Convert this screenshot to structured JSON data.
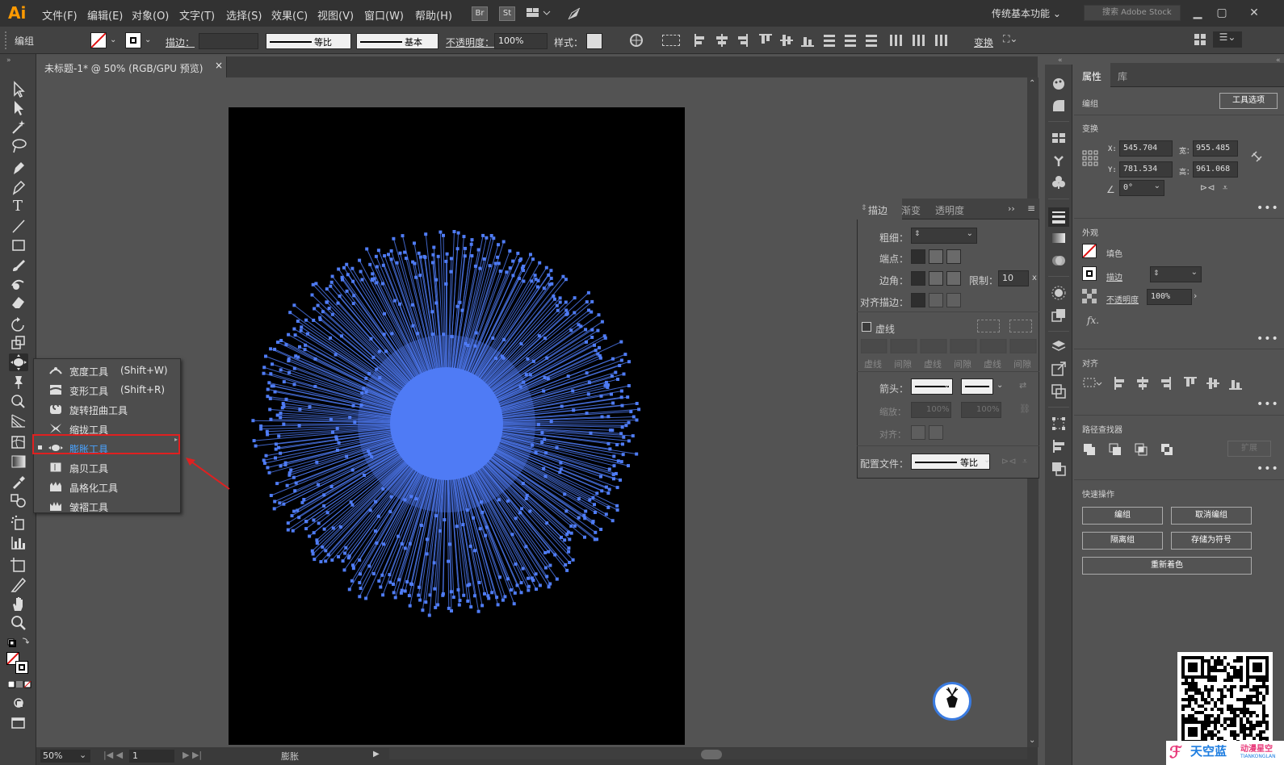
{
  "app": {
    "logo": "Ai",
    "workspace": "传统基本功能",
    "search_placeholder": "搜索 Adobe Stock"
  },
  "menu": [
    "文件(F)",
    "编辑(E)",
    "对象(O)",
    "文字(T)",
    "选择(S)",
    "效果(C)",
    "视图(V)",
    "窗口(W)",
    "帮助(H)"
  ],
  "badges": {
    "br": "Br",
    "st": "St"
  },
  "control_bar": {
    "selection_label": "编组",
    "stroke_label": "描边：",
    "stroke_profile": "等比",
    "brush": "基本",
    "opacity_label": "不透明度：",
    "opacity_value": "100%",
    "style_label": "样式：",
    "transform_label": "变换"
  },
  "document": {
    "tab_title": "未标题-1* @ 50% (RGB/GPU 预览)",
    "close": "×"
  },
  "status": {
    "zoom": "50%",
    "artboard_num": "1",
    "tool_name": "膨胀"
  },
  "flyout": {
    "items": [
      {
        "label": "宽度工具",
        "shortcut": "(Shift+W)",
        "icon": "width-tool-icon"
      },
      {
        "label": "变形工具",
        "shortcut": "(Shift+R)",
        "icon": "warp-tool-icon"
      },
      {
        "label": "旋转扭曲工具",
        "shortcut": "",
        "icon": "twirl-tool-icon"
      },
      {
        "label": "缩拢工具",
        "shortcut": "",
        "icon": "pucker-tool-icon"
      },
      {
        "label": "膨胀工具",
        "shortcut": "",
        "icon": "bloat-tool-icon",
        "selected": true
      },
      {
        "label": "扇贝工具",
        "shortcut": "",
        "icon": "scallop-tool-icon"
      },
      {
        "label": "晶格化工具",
        "shortcut": "",
        "icon": "crystallize-tool-icon"
      },
      {
        "label": "皱褶工具",
        "shortcut": "",
        "icon": "wrinkle-tool-icon"
      }
    ]
  },
  "stroke_panel": {
    "tabs": [
      "描边",
      "渐变",
      "透明度"
    ],
    "weight_label": "粗细：",
    "cap_label": "端点：",
    "corner_label": "边角：",
    "limit_label": "限制：",
    "limit_value": "10",
    "limit_unit": "x",
    "align_label": "对齐描边：",
    "dashed_label": "虚线",
    "dash_labels": [
      "虚线",
      "间隙",
      "虚线",
      "间隙",
      "虚线",
      "间隙"
    ],
    "arrow_label": "箭头：",
    "scale_label": "缩放：",
    "scale_1": "100%",
    "scale_2": "100%",
    "align2_label": "对齐：",
    "profile_label": "配置文件：",
    "profile_value": "等比"
  },
  "properties": {
    "tabs": [
      "属性",
      "库"
    ],
    "selection": "编组",
    "tool_options": "工具选项",
    "transform_head": "变换",
    "x_label": "X:",
    "x_value": "545.704",
    "y_label": "Y:",
    "y_value": "781.534",
    "w_label": "宽：",
    "w_value": "955.485",
    "h_label": "高：",
    "h_value": "961.068",
    "angle_value": "0°",
    "appearance_head": "外观",
    "fill_label": "填色",
    "stroke_label": "描边",
    "opacity_label": "不透明度",
    "opacity_value": "100%",
    "fx": "fx.",
    "align_head": "对齐",
    "pathfinder_head": "路径查找器",
    "expand": "扩展",
    "quick_head": "快速操作",
    "btn_group": "编组",
    "btn_ungroup": "取消编组",
    "btn_isolate": "隔离组",
    "btn_symbol": "存储为符号",
    "btn_recolor": "重新着色"
  },
  "watermark": {
    "brand": "天空蓝",
    "brand2": "动漫星空",
    "url": "TIANKONGLAN"
  },
  "colors": {
    "accent_blue": "#4f7cf5",
    "highlight_red": "#e02020",
    "selected_text": "#4aa3ff",
    "logo_orange": "#ff9a00"
  }
}
